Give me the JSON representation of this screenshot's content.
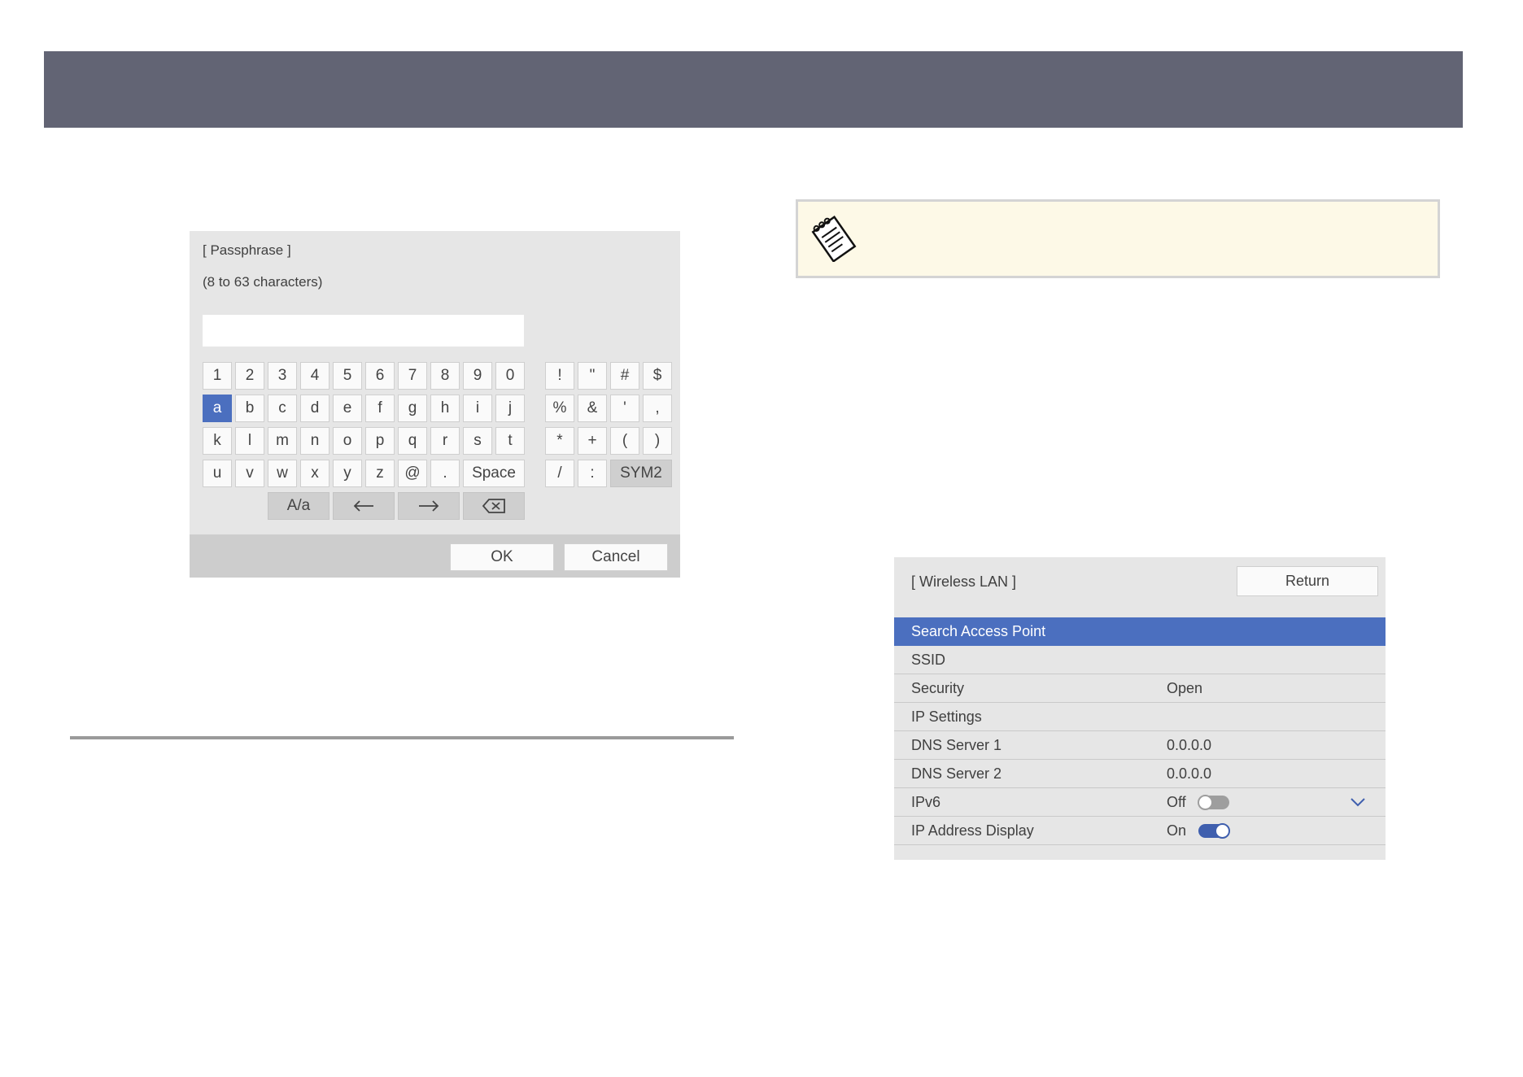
{
  "passphrase_dialog": {
    "title": "[ Passphrase ]",
    "hint": "(8 to 63 characters)",
    "input_value": "",
    "keys": {
      "row1": [
        "1",
        "2",
        "3",
        "4",
        "5",
        "6",
        "7",
        "8",
        "9",
        "0"
      ],
      "row2": [
        "a",
        "b",
        "c",
        "d",
        "e",
        "f",
        "g",
        "h",
        "i",
        "j"
      ],
      "row3": [
        "k",
        "l",
        "m",
        "n",
        "o",
        "p",
        "q",
        "r",
        "s",
        "t"
      ],
      "row4": [
        "u",
        "v",
        "w",
        "x",
        "y",
        "z",
        "@",
        "."
      ],
      "space": "Space",
      "case_toggle": "A/a",
      "symbols_row1": [
        "!",
        "\"",
        "#",
        "$"
      ],
      "symbols_row2": [
        "%",
        "&",
        "'",
        ","
      ],
      "symbols_row3": [
        "*",
        "+",
        "(",
        ")"
      ],
      "symbols_row4": [
        "/",
        ":"
      ],
      "sym_toggle": "SYM2"
    },
    "selected_key": "a",
    "ok_label": "OK",
    "cancel_label": "Cancel"
  },
  "wireless_lan": {
    "title": "[ Wireless LAN ]",
    "return_label": "Return",
    "rows": [
      {
        "label": "Search Access Point",
        "value": "",
        "highlighted": true
      },
      {
        "label": "SSID",
        "value": ""
      },
      {
        "label": "Security",
        "value": "Open"
      },
      {
        "label": "IP Settings",
        "value": ""
      },
      {
        "label": "DNS Server 1",
        "value": "0.0.0.0"
      },
      {
        "label": "DNS Server 2",
        "value": "0.0.0.0"
      },
      {
        "label": "IPv6",
        "value": "Off",
        "toggle": "off"
      },
      {
        "label": "IP Address Display",
        "value": "On",
        "toggle": "on"
      }
    ]
  },
  "colors": {
    "header_bar": "#626474",
    "highlight": "#4b6fbf",
    "toggle_on": "#3f5fae",
    "note_background": "#fdf9e7"
  }
}
